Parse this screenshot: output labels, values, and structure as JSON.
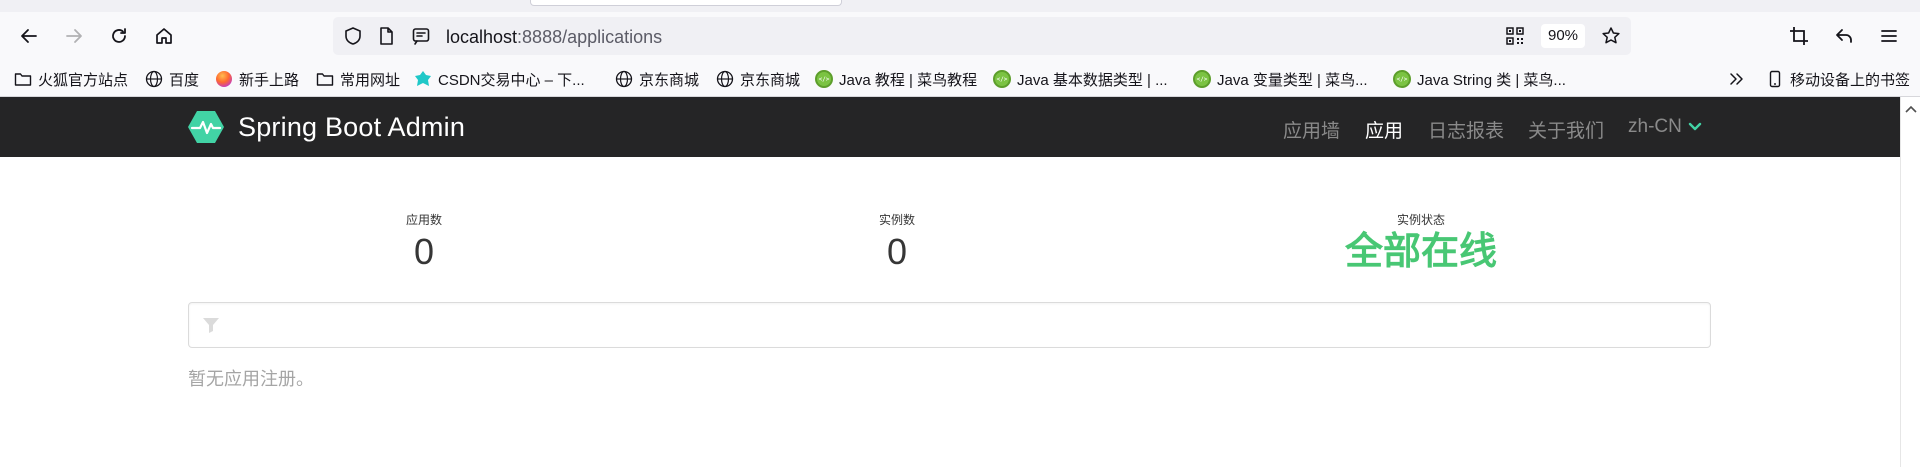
{
  "browser": {
    "url_host": "localhost",
    "url_path": ":8888/applications",
    "zoom": "90%"
  },
  "bookmarks": [
    {
      "label": "火狐官方站点",
      "icon": "folder-icon"
    },
    {
      "label": "百度",
      "icon": "globe-icon"
    },
    {
      "label": "新手上路",
      "icon": "firefox-icon"
    },
    {
      "label": "常用网址",
      "icon": "folder-icon"
    },
    {
      "label": "CSDN交易中心 – 下...",
      "icon": "csdn-icon"
    },
    {
      "label": "京东商城",
      "icon": "globe-icon"
    },
    {
      "label": "京东商城",
      "icon": "globe-icon"
    },
    {
      "label": "Java 教程 | 菜鸟教程",
      "icon": "runoob-icon"
    },
    {
      "label": "Java 基本数据类型 | ...",
      "icon": "runoob-icon"
    },
    {
      "label": "Java 变量类型 | 菜鸟...",
      "icon": "runoob-icon"
    },
    {
      "label": "Java String 类 | 菜鸟...",
      "icon": "runoob-icon"
    }
  ],
  "mobile_bookmarks": "移动设备上的书签",
  "app": {
    "title": "Spring Boot Admin",
    "nav": [
      "应用墙",
      "应用",
      "日志报表",
      "关于我们"
    ],
    "language": "zh-CN",
    "accent": "#42d3a5"
  },
  "stats": {
    "applications_label": "应用数",
    "applications_value": "0",
    "instances_label": "实例数",
    "instances_value": "0",
    "status_label": "实例状态",
    "status_value": "全部在线",
    "status_color": "#48c774"
  },
  "filter": {
    "value": ""
  },
  "empty_message": "暂无应用注册。"
}
